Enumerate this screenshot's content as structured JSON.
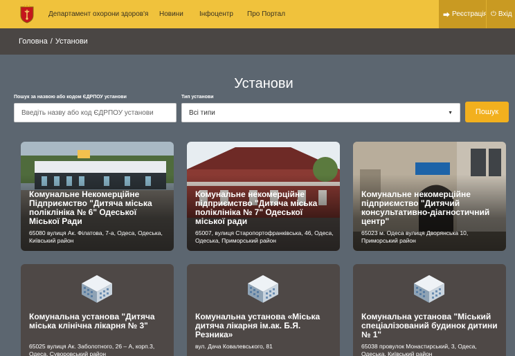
{
  "nav": {
    "links": [
      "Департамент охорони здоров'я",
      "Новини",
      "Інфоцентр",
      "Про Портал"
    ],
    "register": "Реєстрація",
    "login": "Вхід",
    "accent": "#f0c23c"
  },
  "breadcrumb": {
    "home": "Головна",
    "separator": "/",
    "current": "Установи"
  },
  "page": {
    "title": "Установи"
  },
  "filters": {
    "search_label": "Пошук за назвою або кодом ЄДРПОУ установи",
    "search_placeholder": "Введіть назву або код ЄДРПОУ установи",
    "search_value": "",
    "type_label": "Тип установи",
    "type_selected": "Всі типи",
    "search_button": "Пошук"
  },
  "cards": [
    {
      "title": "Комунальне Некомерційне Підприємство \"Дитяча міська поліклініка № 6\" Одеської Міської Ради",
      "address": "65080 вулиця Ак. Філатова, 7-а, Одеса, Одеська, Київський район",
      "image": "photo"
    },
    {
      "title": "Комунальне некомерційне підприємство \"Дитяча міська поліклініка № 7\" Одеської міської ради",
      "address": "65007, вулиця Старопортофранківська, 46, Одеса, Одеська, Приморський район",
      "image": "photo"
    },
    {
      "title": "Комунальне некомерційне підприємство \"Дитячий консультативно-діагностичний центр\"",
      "address": "65023 м. Одеса вулиця Дворянська 10, Приморський район",
      "image": "photo"
    },
    {
      "title": "Комунальна установа \"Дитяча міська клінічна лікарня № 3\"",
      "address": "65025 вулиця Ак. Заболотного, 26 – А, корп.3, Одеса, Суворовський район",
      "image": "building-icon"
    },
    {
      "title": "Комунальна установа «Міська дитяча лікарня ім.ак. Б.Я. Резника»",
      "address": "вул. Дача Ковалевського, 81",
      "image": "building-icon"
    },
    {
      "title": "Комунальна установа \"Міський спеціалізований будинок дитини № 1\"",
      "address": "65038 провулок Монастирський, 3, Одеса, Одеська, Київський район",
      "image": "building-icon"
    }
  ]
}
